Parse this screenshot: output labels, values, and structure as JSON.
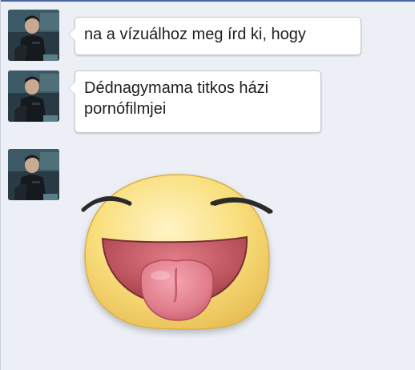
{
  "messages": [
    {
      "text": "na a vízuálhoz meg írd ki, hogy"
    },
    {
      "text": "Dédnagymama titkos házi pornófilmjei"
    }
  ],
  "sticker": {
    "icon": "laughing-tongue-out-sticker",
    "colors": {
      "face": "#f9df7d",
      "face_edge": "#e8c25a",
      "mouth": "#b8505a",
      "tongue": "#e07d8c"
    }
  },
  "colors": {
    "background": "#eceff5",
    "accent": "#4a63a0",
    "bubble": "#ffffff",
    "bubble_border": "#c4c8d2"
  }
}
